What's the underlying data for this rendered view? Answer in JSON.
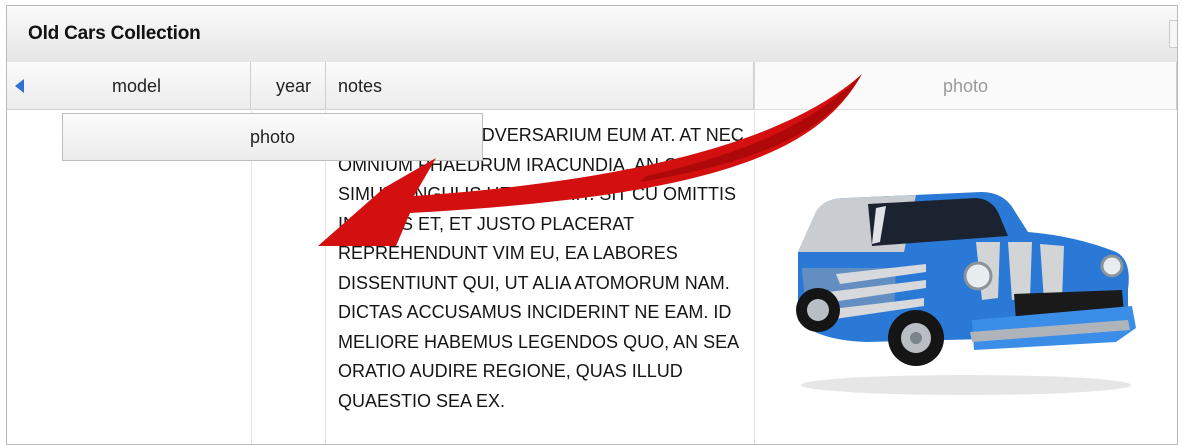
{
  "panel": {
    "title": "Old Cars Collection"
  },
  "columns": {
    "model": "model",
    "year": "year",
    "notes": "notes",
    "photo": "photo"
  },
  "drag_proxy": {
    "label": "photo"
  },
  "row": {
    "notes": "Vero essent adversarium eum at. At nec omnium phaedrum iracundia, an qui simul singulis hendrerit. Sit cu omittis inermis et, et justo placerat reprehendunt vim eu, ea labores dissentiunt qui, ut alia atomorum nam. Dictas accusamus inciderint ne eam. Id meliore habemus legendos quo, an sea oratio audire regione, quas illud quaestio sea ex."
  },
  "icons": {
    "scroll_left": "triangle-left-icon",
    "drag_arrow": "curved-arrow-icon"
  },
  "colors": {
    "accent": "#2f6fd6",
    "arrow": "#d40f0f",
    "car_body": "#2a79d6"
  }
}
